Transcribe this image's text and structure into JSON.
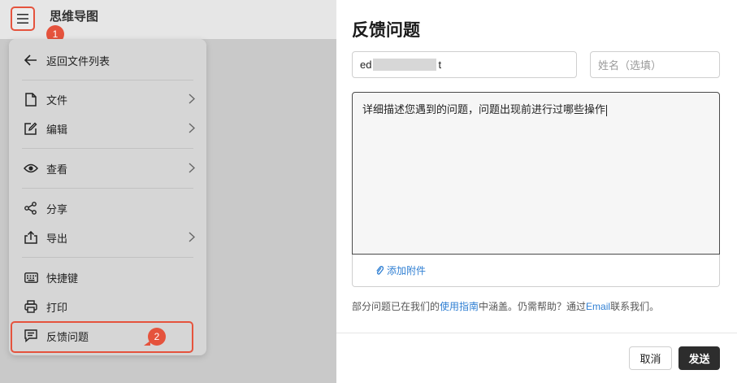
{
  "app": {
    "title": "思维导图",
    "annotation_1": "1",
    "annotation_2": "2"
  },
  "menu": {
    "back": "返回文件列表",
    "file": "文件",
    "edit": "编辑",
    "view": "查看",
    "share": "分享",
    "export": "导出",
    "shortcuts": "快捷键",
    "print": "打印",
    "feedback": "反馈问题"
  },
  "feedback": {
    "title": "反馈问题",
    "email_prefix": "ed",
    "email_suffix": "t",
    "name_placeholder": "姓名（选填）",
    "description": "详细描述您遇到的问题，问题出现前进行过哪些操作",
    "attach_label": "添加附件",
    "help_part1": "部分问题已在我们的",
    "help_link1": "使用指南",
    "help_part2": "中涵盖。仍需帮助？通过",
    "help_link2": "Email",
    "help_part3": "联系我们。",
    "cancel_label": "取消",
    "send_label": "发送"
  },
  "colors": {
    "annotation": "#e5533d",
    "link": "#2f7fd3",
    "primary_button": "#2d2d2d"
  }
}
